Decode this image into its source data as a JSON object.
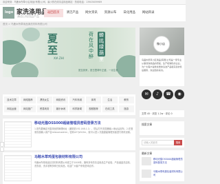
{
  "topbar": {
    "text": "欢迎来到：鸟鹿木所草小区用品(有限)公司，最小的在线清洁用品网站 · 热线电话：13905659989"
  },
  "header": {
    "logo_text": "logo",
    "site_name": "家洗涤用品",
    "site_sub": "清洁日化用品产品"
  },
  "nav": {
    "items": [
      {
        "label": "返回首页",
        "active": true
      },
      {
        "label": "清洁产品",
        "active": false
      },
      {
        "label": "网文资讯",
        "active": false
      },
      {
        "label": "资源公布",
        "active": false
      },
      {
        "label": "日化用品",
        "active": false
      },
      {
        "label": "网站目录",
        "active": false
      }
    ]
  },
  "breadcrumb": "首页 > 鸟鹿木所草用品清洗材料有限公司",
  "banner": {
    "big_text": "夏\n至",
    "pinyin": "XIA ZHI",
    "cols": [
      "荷在风中醉",
      "蝉鸣绿荫里"
    ],
    "caption": "夏至到来，夏日里荷叶正盛，一派生机"
  },
  "categories": [
    "技术文章",
    "网络推荐",
    "漂亮女生",
    "网络资讯",
    "汽车商城",
    "体育",
    "生活",
    "教育",
    "网站运营",
    "网站推广",
    "贸易商务",
    "娱乐休闲",
    "科学新闻",
    "视频推荐",
    "在线工具",
    "旅游"
  ],
  "articles": [
    {
      "title": "移动光猫OSS000超级管理员密码登录方法",
      "excerpt": "1.首先要确定光猫背面的管理地址（通常是192.168.1.1），然后打开浏览器输入地址后回车；2.在登录页面输入用户名telecomadmin，密码nE7jA%5m，就可以进入光猫超级管理页面进行修改设置。"
    },
    {
      "title": "马鞍木草鸡蛋包装材料有限公司",
      "excerpt": "鸟鹿木所草用品清洗材料有限公司成立于2008年，拥有多年的清洁用品生产经验，产品涵盖洗洁精、洗衣液、洗手液等多种日化用品，欢迎广大客户来电咨询合作。"
    }
  ],
  "author": {
    "avatar_text": "微小店",
    "desc": "鸟鹿木所草小区用品(有限)公司是一家专业从事洗涤用品的研发、生产和销售的企业，为广大客户提供优质的清洁产品和完善的售后服务，欢迎您的来访。"
  },
  "social": [
    "✉",
    "♪",
    "☎",
    "◉"
  ],
  "stats": {
    "text": "文章 45 · 浏览 1.2w · 评论 0"
  },
  "search": {
    "title": "搜索文章",
    "placeholder": "请输入关键词",
    "button": "搜索"
  },
  "latest": {
    "title": "最新文章",
    "items": [
      {
        "title": "移动光猫OSS000超级管理员密码登录方法",
        "date": "2023-06-21"
      },
      {
        "title": "马鞍木草鸡蛋包装材料有限公司",
        "date": "2023-06-20"
      }
    ]
  }
}
